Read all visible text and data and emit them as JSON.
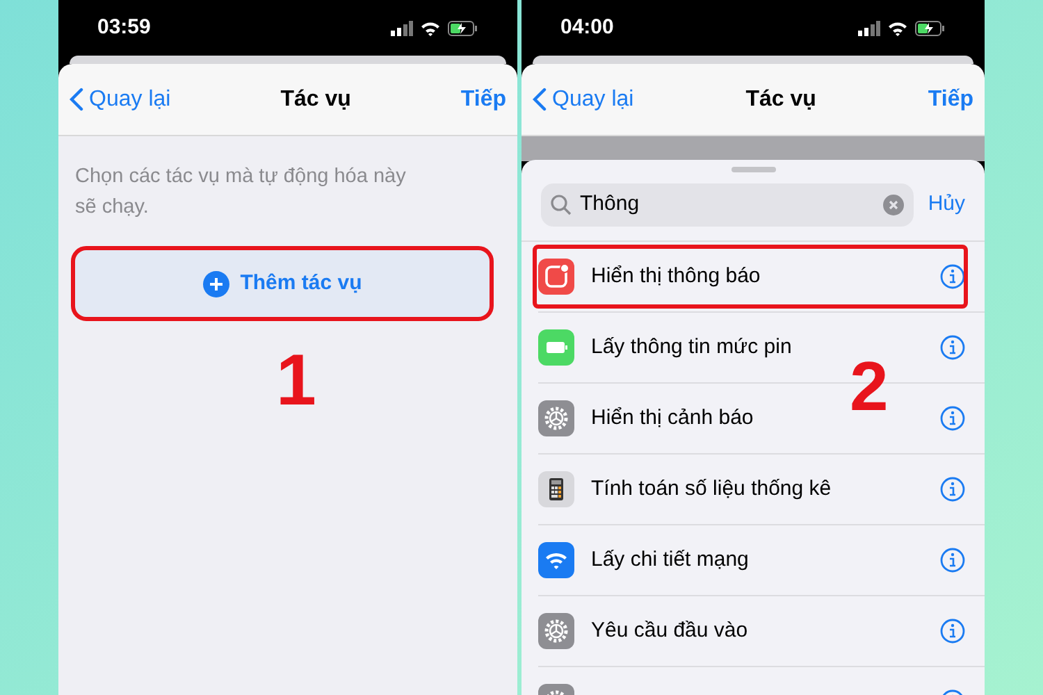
{
  "screens": [
    {
      "status_bar": {
        "time": "03:59"
      },
      "nav": {
        "back": "Quay lại",
        "title": "Tác vụ",
        "next": "Tiếp"
      },
      "hint": "Chọn các tác vụ mà tự động hóa này sẽ chạy.",
      "add_button": {
        "label": "Thêm tác vụ",
        "highlighted": true
      },
      "step": "1"
    },
    {
      "status_bar": {
        "time": "04:00"
      },
      "nav": {
        "back": "Quay lại",
        "title": "Tác vụ",
        "next": "Tiếp"
      },
      "search": {
        "value": "Thông",
        "cancel": "Hủy"
      },
      "step": "2",
      "actions": [
        {
          "kind": "notification",
          "label": "Hiển thị thông báo",
          "highlighted": true
        },
        {
          "kind": "battery",
          "label": "Lấy thông tin mức pin",
          "highlighted": false
        },
        {
          "kind": "gear",
          "label": "Hiển thị cảnh báo",
          "highlighted": false
        },
        {
          "kind": "calculator",
          "label": "Tính toán số liệu thống kê",
          "highlighted": false
        },
        {
          "kind": "wifi",
          "label": "Lấy chi tiết mạng",
          "highlighted": false
        },
        {
          "kind": "gear",
          "label": "Yêu cầu đầu vào",
          "highlighted": false
        },
        {
          "kind": "gear",
          "highlighted": false
        }
      ]
    }
  ]
}
